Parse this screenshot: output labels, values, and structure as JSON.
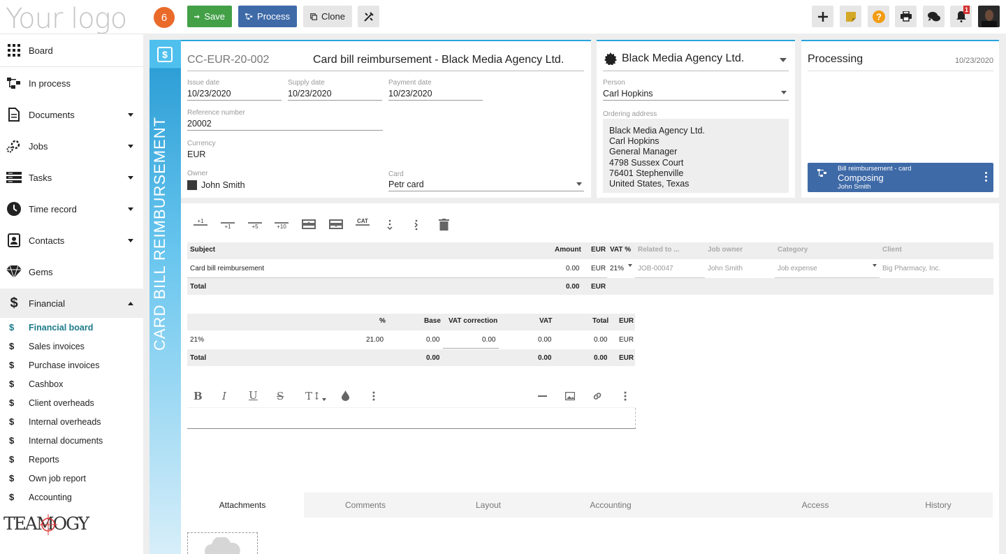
{
  "app": {
    "logo_text": "Your logo",
    "brand_text": "TEAMOGY"
  },
  "toolbar": {
    "badge_count": "6",
    "save_label": "Save",
    "process_label": "Process",
    "clone_label": "Clone",
    "notification_count": "1"
  },
  "sidebar": {
    "items": [
      {
        "label": "Board",
        "icon": "grid-icon"
      },
      {
        "label": "In process",
        "icon": "process-icon"
      },
      {
        "label": "Documents",
        "icon": "document-icon"
      },
      {
        "label": "Jobs",
        "icon": "jobs-icon"
      },
      {
        "label": "Tasks",
        "icon": "tasks-icon"
      },
      {
        "label": "Time record",
        "icon": "clock-icon"
      },
      {
        "label": "Contacts",
        "icon": "contacts-icon"
      },
      {
        "label": "Gems",
        "icon": "gem-icon"
      },
      {
        "label": "Financial",
        "icon": "dollar-icon"
      }
    ],
    "financial_sub": [
      {
        "label": "Financial board"
      },
      {
        "label": "Sales invoices"
      },
      {
        "label": "Purchase invoices"
      },
      {
        "label": "Cashbox"
      },
      {
        "label": "Client overheads"
      },
      {
        "label": "Internal overheads"
      },
      {
        "label": "Internal documents"
      },
      {
        "label": "Reports"
      },
      {
        "label": "Own job report"
      },
      {
        "label": "Accounting"
      }
    ]
  },
  "doc": {
    "vertical_title": "CARD BILL REIMBURSEMENT",
    "number": "CC-EUR-20-002",
    "title": "Card bill reimbursement - Black Media Agency Ltd.",
    "issue_date_label": "Issue date",
    "issue_date": "10/23/2020",
    "supply_date_label": "Supply date",
    "supply_date": "10/23/2020",
    "payment_date_label": "Payment date",
    "payment_date": "10/23/2020",
    "reference_label": "Reference number",
    "reference": "20002",
    "currency_label": "Currency",
    "currency": "EUR",
    "owner_label": "Owner",
    "owner": "John Smith",
    "card_label": "Card",
    "card": "Petr card"
  },
  "client": {
    "name": "Black Media Agency Ltd.",
    "person_label": "Person",
    "person": "Carl Hopkins",
    "address_label": "Ordering address",
    "address_lines": [
      "Black Media Agency Ltd.",
      "Carl Hopkins",
      "General Manager",
      "4798 Sussex Court",
      "76401 Stephenville",
      "United States, Texas"
    ]
  },
  "status": {
    "title": "Processing",
    "date": "10/23/2020",
    "workflow_name": "Bill reimbursement - card",
    "workflow_step": "Composing",
    "workflow_user": "John Smith"
  },
  "items_table": {
    "toolbar_labels": {
      "add1": "+1",
      "add1b": "+1",
      "add5": "+5",
      "add10": "+10",
      "cat": "CAT"
    },
    "headers": {
      "subject": "Subject",
      "amount": "Amount",
      "currency": "EUR",
      "vat": "VAT %",
      "related": "Related to ...",
      "job_owner": "Job owner",
      "category": "Category",
      "client": "Client"
    },
    "row": {
      "subject": "Card bill reimbursement",
      "amount": "0.00",
      "currency": "EUR",
      "vat": "21%",
      "related": "JOB-00047",
      "job_owner": "John Smith",
      "category": "Job expense",
      "client": "Big Pharmacy, Inc."
    },
    "total_label": "Total",
    "total_amount": "0.00",
    "total_currency": "EUR"
  },
  "vat_table": {
    "headers": {
      "pct": "%",
      "base": "Base",
      "correction": "VAT correction",
      "vat": "VAT",
      "total": "Total",
      "currency": "EUR"
    },
    "row": {
      "label": "21%",
      "pct": "21.00",
      "base": "0.00",
      "correction": "0.00",
      "vat": "0.00",
      "total": "0.00",
      "currency": "EUR"
    },
    "total": {
      "label": "Total",
      "base": "0.00",
      "vat": "0.00",
      "total": "0.00",
      "currency": "EUR"
    }
  },
  "tabs": [
    {
      "label": "Attachments"
    },
    {
      "label": "Comments"
    },
    {
      "label": "Layout"
    },
    {
      "label": "Accounting"
    },
    {
      "label": "Access"
    },
    {
      "label": "History"
    }
  ],
  "colors": {
    "save": "#43a047",
    "process": "#3f6aa8",
    "accent": "#27a4dd",
    "workflow": "#3f6aa8",
    "badge": "#ea6a2a"
  }
}
